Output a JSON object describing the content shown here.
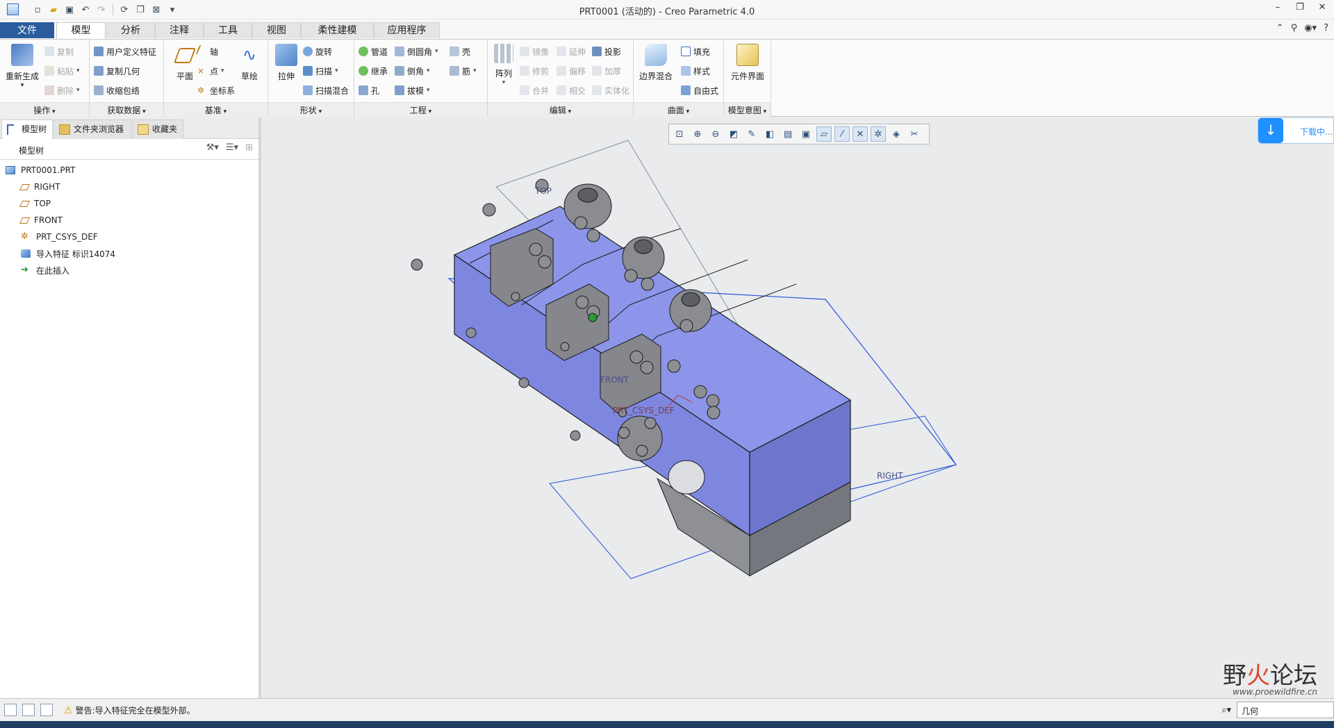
{
  "window": {
    "title": "PRT0001 (活动的) - Creo Parametric 4.0",
    "controls": {
      "minimize": "–",
      "restore": "❐",
      "close": "✕"
    }
  },
  "quick_access": [
    "new-icon",
    "open-icon",
    "save-icon",
    "undo-icon",
    "redo-icon",
    "regenerate-icon",
    "windows-icon",
    "close-window-icon",
    "customize-icon"
  ],
  "tabs": [
    "文件",
    "模型",
    "分析",
    "注释",
    "工具",
    "视图",
    "柔性建模",
    "应用程序"
  ],
  "active_tab": "模型",
  "ribbon": {
    "ops": {
      "label": "操作",
      "regen": "重新生成",
      "copy": "复制",
      "paste": "粘贴",
      "delete": "删除"
    },
    "getdata": {
      "label": "获取数据",
      "udf": "用户定义特征",
      "copygeom": "复制几何",
      "shrinkwrap": "收缩包络"
    },
    "datum": {
      "label": "基准",
      "plane": "平面",
      "axis": "轴",
      "point": "点",
      "csys": "坐标系",
      "sketch": "草绘"
    },
    "shapes": {
      "label": "形状",
      "extrude": "拉伸",
      "revolve": "旋转",
      "sweep": "扫描",
      "swept_blend": "扫描混合"
    },
    "engineering": {
      "label": "工程",
      "pipe": "管道",
      "round": "倒圆角",
      "shell": "壳",
      "inherit": "继承",
      "chamfer": "倒角",
      "rib": "筋",
      "hole": "孔",
      "draft": "拔模"
    },
    "editing": {
      "label": "编辑",
      "pattern": "阵列",
      "mirror": "镜像",
      "extend": "延伸",
      "project": "投影",
      "trim": "修剪",
      "offset": "偏移",
      "thicken": "加厚",
      "merge": "合并",
      "intersect": "相交",
      "solidify": "实体化"
    },
    "surfaces": {
      "label": "曲面",
      "boundary": "边界混合",
      "fill": "填充",
      "style": "样式",
      "freestyle": "自由式"
    },
    "intent": {
      "label": "模型意图",
      "component_interface": "元件界面"
    }
  },
  "left_panel": {
    "tabs": [
      "模型树",
      "文件夹浏览器",
      "收藏夹"
    ],
    "title": "模型树",
    "tree": [
      {
        "label": "PRT0001.PRT",
        "icon": "part-icon"
      },
      {
        "label": "RIGHT",
        "icon": "datum-plane-icon"
      },
      {
        "label": "TOP",
        "icon": "datum-plane-icon"
      },
      {
        "label": "FRONT",
        "icon": "datum-plane-icon"
      },
      {
        "label": "PRT_CSYS_DEF",
        "icon": "csys-icon"
      },
      {
        "label": "导入特征 标识14074",
        "icon": "import-feature-icon"
      },
      {
        "label": "在此插入",
        "icon": "insert-arrow-icon"
      }
    ]
  },
  "viewport": {
    "plane_labels": {
      "top": "TOP",
      "front": "FRONT",
      "right": "RIGHT",
      "csys": "PRT_CSYS_DEF"
    },
    "download": "下载中..."
  },
  "status": {
    "message": "警告:导入特征完全在模型外部。",
    "filter": "几何"
  },
  "watermark": {
    "main": "野火论坛",
    "url": "www.proewildfire.cn"
  },
  "colors": {
    "model": "#8c95ea",
    "model_dark": "#6d76cc",
    "plane": "#2a55d8",
    "file_tab": "#2b5d9c"
  }
}
